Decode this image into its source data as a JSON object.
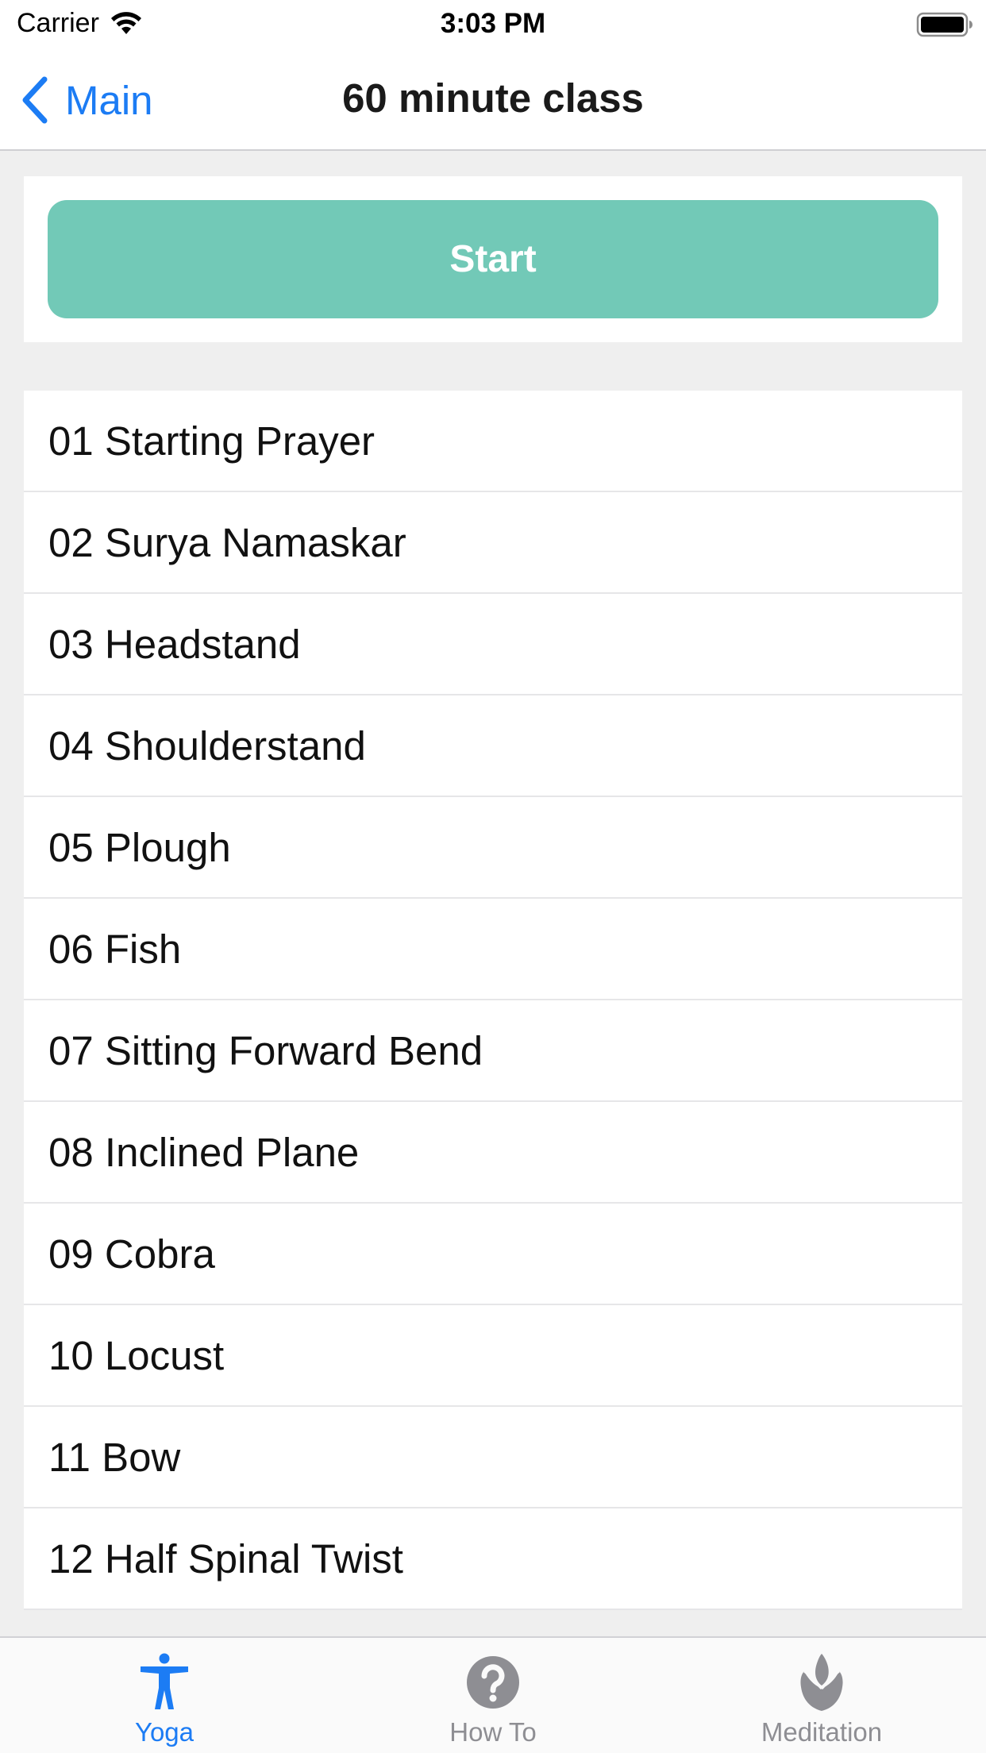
{
  "status_bar": {
    "carrier": "Carrier",
    "time": "3:03 PM"
  },
  "nav": {
    "back_label": "Main",
    "title": "60 minute class"
  },
  "start_button": {
    "label": "Start",
    "color": "#72c9b7"
  },
  "poses": [
    "01 Starting Prayer",
    "02 Surya Namaskar",
    "03 Headstand",
    "04 Shoulderstand",
    "05 Plough",
    "06 Fish",
    "07 Sitting Forward Bend",
    "08 Inclined Plane",
    "09 Cobra",
    "10 Locust",
    "11 Bow",
    "12 Half Spinal Twist"
  ],
  "tabs": [
    {
      "label": "Yoga",
      "icon": "person-icon",
      "active": true
    },
    {
      "label": "How To",
      "icon": "question-icon",
      "active": false
    },
    {
      "label": "Meditation",
      "icon": "lotus-icon",
      "active": false
    }
  ],
  "colors": {
    "accent": "#1c7cf4",
    "inactive": "#8e8e93"
  }
}
